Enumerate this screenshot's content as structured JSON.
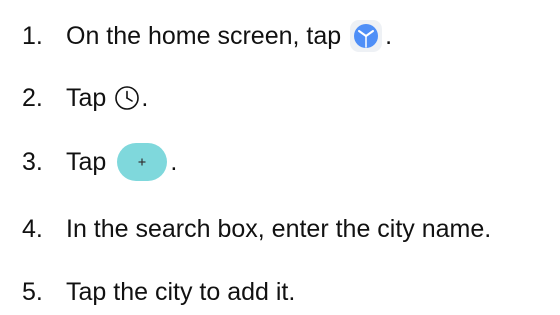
{
  "steps": [
    {
      "number": "1.",
      "text": "On the home screen, tap",
      "icon": "clock-app-icon",
      "suffix": "."
    },
    {
      "number": "2.",
      "text": "Tap",
      "icon": "clock-outline-icon",
      "suffix": "."
    },
    {
      "number": "3.",
      "text": "Tap",
      "icon": "add-button-icon",
      "suffix": "."
    },
    {
      "number": "4.",
      "text": "In the search box, enter the city name."
    },
    {
      "number": "5.",
      "text": "Tap the city to add it."
    }
  ],
  "colors": {
    "text": "#111111",
    "clock_app_blue": "#4f8ff7",
    "add_button_teal": "#7fd8dc"
  }
}
